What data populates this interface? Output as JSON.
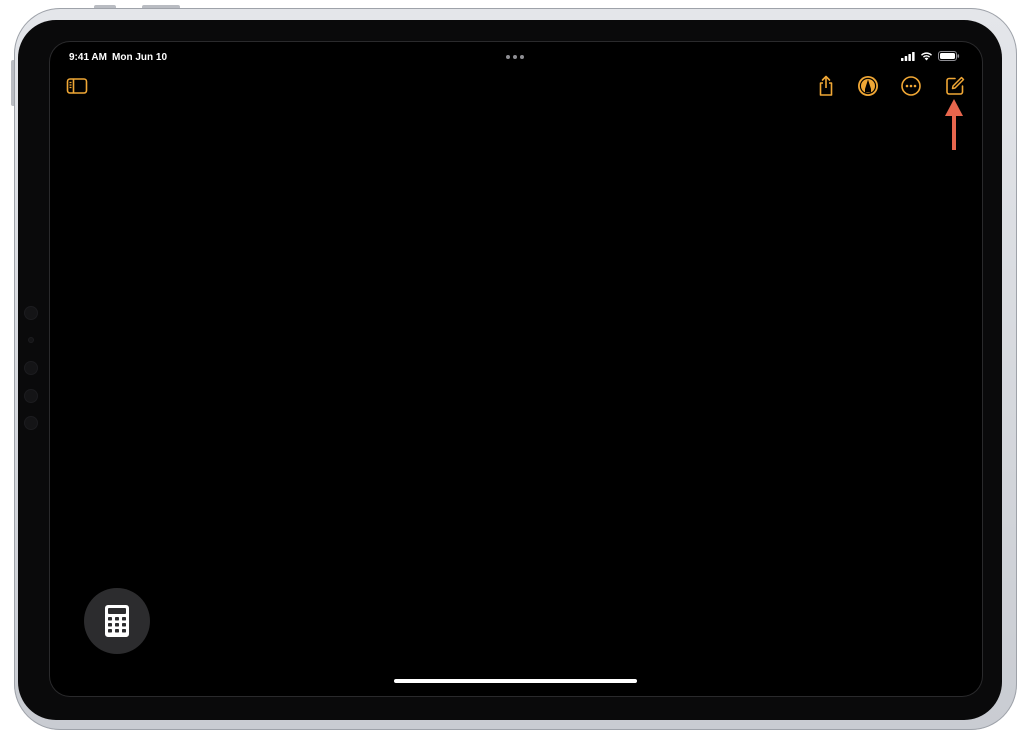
{
  "status_bar": {
    "time": "9:41 AM",
    "date": "Mon Jun 10"
  },
  "toolbar": {
    "sidebar_icon": "sidebar-toggle-icon",
    "share_icon": "share-icon",
    "markup_icon": "markup-pen-icon",
    "more_icon": "ellipsis-circle-icon",
    "compose_icon": "compose-icon"
  },
  "floating": {
    "calculator_icon": "calculator-icon"
  },
  "colors": {
    "accent": "#f0a735",
    "annotation_arrow": "#e8664d",
    "screen_bg": "#000000",
    "floating_button_bg": "#2c2c2e"
  }
}
